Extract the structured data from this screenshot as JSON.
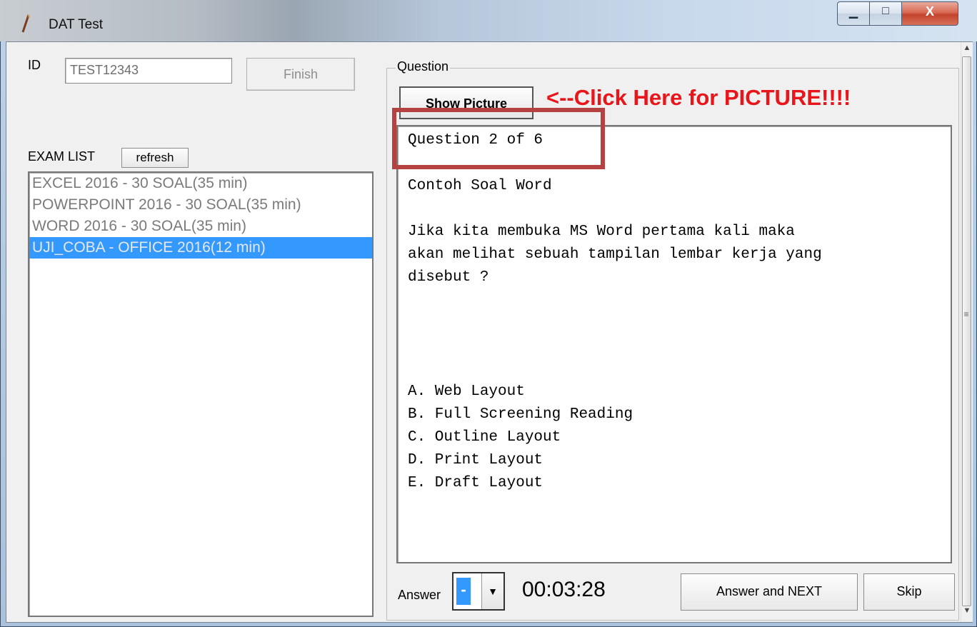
{
  "window": {
    "title": "DAT Test",
    "min_glyph": "▁",
    "max_glyph": "□",
    "close_glyph": "X"
  },
  "left": {
    "id_label": "ID",
    "id_value": "TEST12343",
    "finish_label": "Finish",
    "exam_list_label": "EXAM LIST",
    "refresh_label": "refresh",
    "exams": [
      "EXCEL 2016 - 30 SOAL(35 min)",
      "POWERPOINT 2016 - 30 SOAL(35 min)",
      "WORD 2016 - 30 SOAL(35 min)",
      "UJI_COBA - OFFICE 2016(12 min)"
    ],
    "selected_exam_index": 3
  },
  "question": {
    "group_label": "Question",
    "show_picture_label": "Show Picture",
    "callout": "<--Click Here for PICTURE!!!!",
    "counter": "Question 2 of 6",
    "title": "Contoh Soal Word",
    "body": [
      "Jika kita membuka MS Word pertama kali maka",
      "akan melihat sebuah tampilan lembar kerja yang",
      "disebut ?"
    ],
    "options": [
      "A. Web Layout",
      "B. Full Screening Reading",
      "C. Outline Layout",
      "D. Print Layout",
      "E. Draft Layout"
    ],
    "highlight_color": "#b54141"
  },
  "footer": {
    "answer_label": "Answer",
    "answer_value": "-",
    "timer": "00:03:28",
    "answer_next_label": "Answer and NEXT",
    "skip_label": "Skip"
  },
  "colors": {
    "selection": "#3399ff",
    "callout": "#e8151b"
  }
}
